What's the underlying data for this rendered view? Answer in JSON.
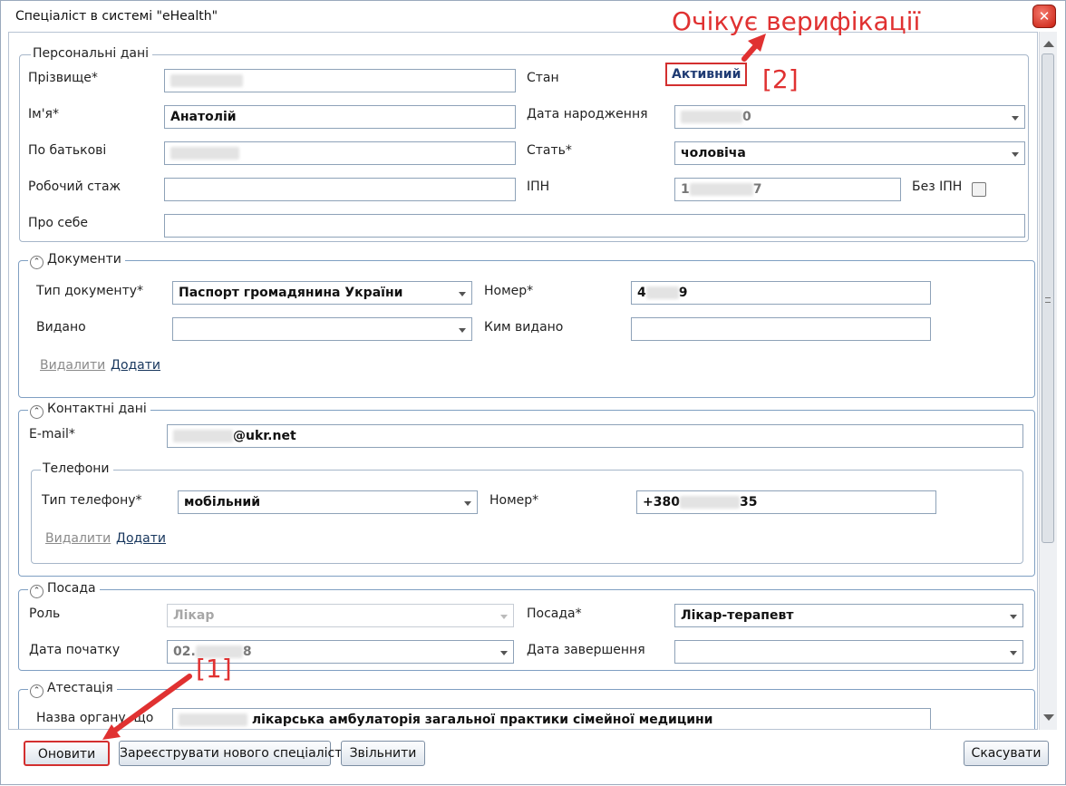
{
  "window": {
    "title": "Спеціаліст в системі \"eHealth\"",
    "close_glyph": "✕"
  },
  "annotations": {
    "verification": "Очікує верифікації",
    "marker_2": "[2]",
    "marker_1": "[1]",
    "color": "#e03131"
  },
  "personal": {
    "legend": "Персональні дані",
    "surname_label": "Прізвище*",
    "surname_value": "██████",
    "name_label": "Ім'я*",
    "name_value": "Анатолій",
    "patronymic_label": "По батькові",
    "patronymic_value": "██████",
    "experience_label": "Робочий стаж",
    "experience_value": "",
    "about_label": "Про себе",
    "about_value": "",
    "status_label": "Стан",
    "status_value": "Активний",
    "birthdate_label": "Дата народження",
    "birthdate_prefix": "",
    "birthdate_suffix": "0",
    "gender_label": "Стать*",
    "gender_value": "чоловіча",
    "ipn_label": "ІПН",
    "ipn_prefix": "1",
    "ipn_suffix": "7",
    "no_ipn_label": "Без ІПН"
  },
  "documents": {
    "legend": "Документи",
    "type_label": "Тип документу*",
    "type_value": "Паспорт громадянина України",
    "number_label": "Номер*",
    "number_prefix": "4",
    "number_suffix": "9",
    "issued_label": "Видано",
    "issued_value": "",
    "issuer_label": "Ким видано",
    "issuer_value": "",
    "delete_link": "Видалити",
    "add_link": "Додати"
  },
  "contacts": {
    "legend": "Контактні дані",
    "email_label": "E-mail*",
    "email_suffix": "@ukr.net",
    "phones": {
      "legend": "Телефони",
      "type_label": "Тип телефону*",
      "type_value": "мобільний",
      "number_label": "Номер*",
      "number_prefix": "+380",
      "number_suffix": "35",
      "delete_link": "Видалити",
      "add_link": "Додати"
    }
  },
  "position": {
    "legend": "Посада",
    "role_label": "Роль",
    "role_value": "Лікар",
    "position_label": "Посада*",
    "position_value": "Лікар-терапевт",
    "start_label": "Дата початку",
    "start_prefix": "02.",
    "start_suffix": "8",
    "end_label": "Дата завершення",
    "end_value": ""
  },
  "attestation": {
    "legend": "Атестація",
    "org_label": "Назва органу, що",
    "org_value": "лікарська амбулаторія загальної практики сімейної медицини"
  },
  "footer": {
    "update": "Оновити",
    "register": "Зареєструвати нового спеціаліста",
    "dismiss": "Звільнити",
    "cancel": "Скасувати"
  }
}
